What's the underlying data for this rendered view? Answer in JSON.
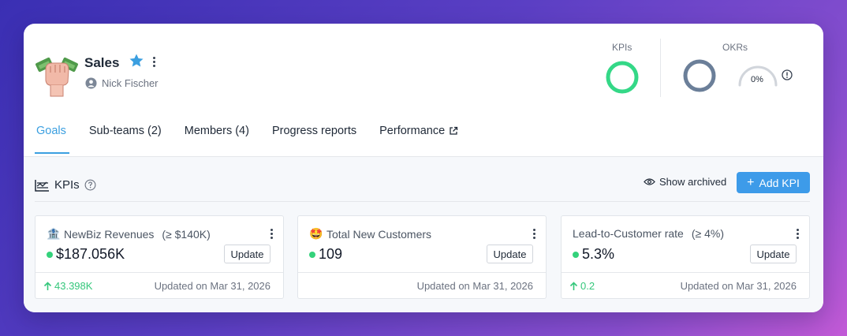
{
  "team": {
    "title": "Sales",
    "owner": "Nick Fischer",
    "avatar_icon": "money-fist-icon"
  },
  "metrics": {
    "kpis_label": "KPIs",
    "okrs_label": "OKRs",
    "okr_progress": "0%",
    "colors": {
      "kpi_ring": "#34d887",
      "okr_ring": "#6b7f99",
      "gauge": "#d1d5db"
    }
  },
  "tabs": [
    {
      "label": "Goals",
      "active": true
    },
    {
      "label": "Sub-teams (2)"
    },
    {
      "label": "Members (4)"
    },
    {
      "label": "Progress reports"
    },
    {
      "label": "Performance"
    }
  ],
  "kpi_section": {
    "title": "KPIs",
    "show_archived": "Show archived",
    "add_button": "Add KPI",
    "accent": "#3d9be9"
  },
  "kpis": [
    {
      "emoji": "🏦",
      "name": "NewBiz Revenues",
      "target": "(≥ $140K)",
      "value": "$187.056K",
      "update_label": "Update",
      "delta": "43.398K",
      "updated": "Updated on Mar 31, 2026"
    },
    {
      "emoji": "🤩",
      "name": "Total New Customers",
      "target": "",
      "value": "109",
      "update_label": "Update",
      "delta": "",
      "updated": "Updated on Mar 31, 2026"
    },
    {
      "emoji": "",
      "name": "Lead-to-Customer rate",
      "target": "(≥ 4%)",
      "value": "5.3%",
      "update_label": "Update",
      "delta": "0.2",
      "updated": "Updated on Mar 31, 2026"
    }
  ]
}
